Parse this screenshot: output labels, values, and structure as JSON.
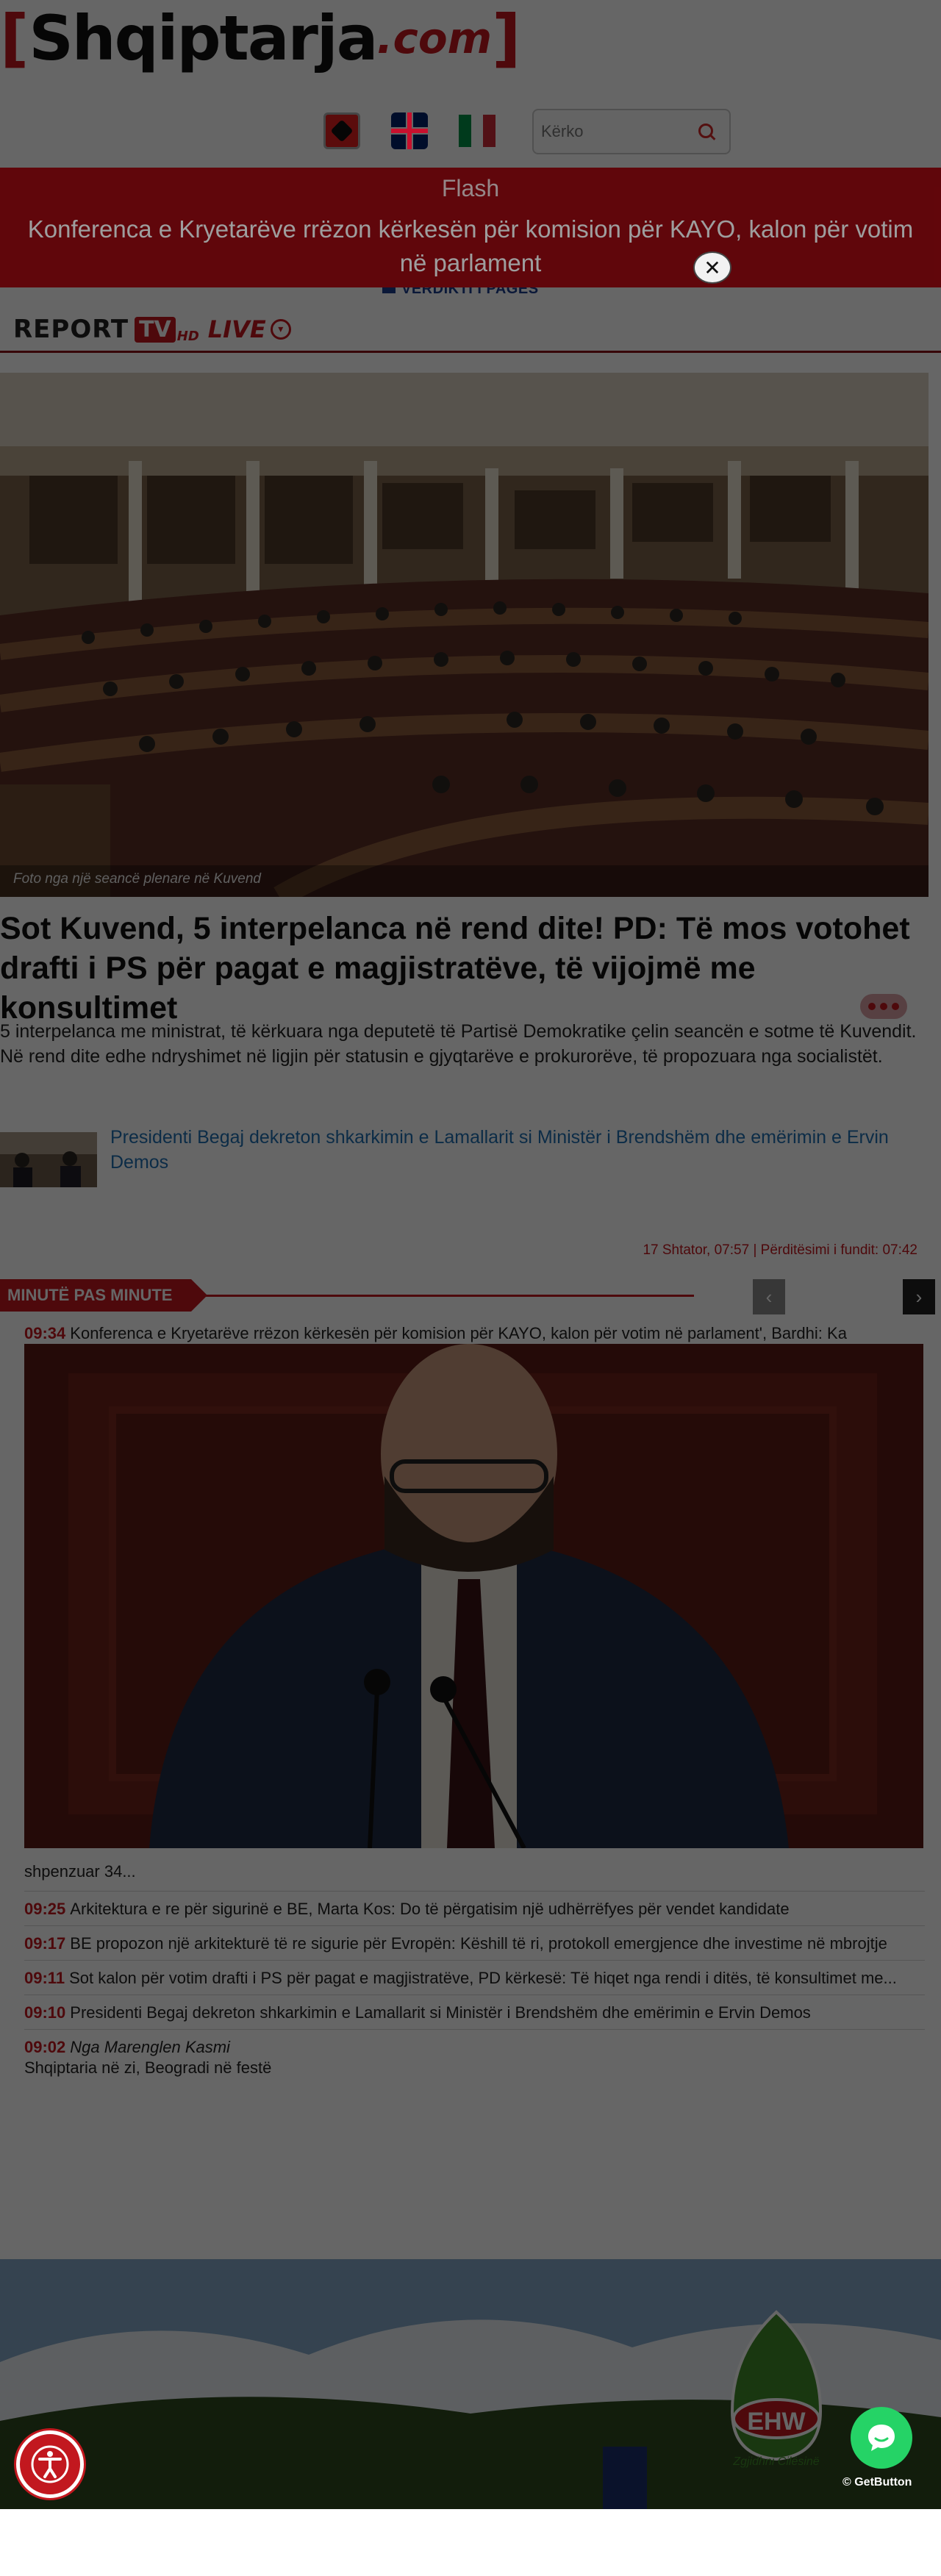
{
  "site": {
    "logo_left_bracket": "[",
    "logo_name": "Shqiptarja",
    "logo_suffix": ".com",
    "logo_right_bracket": "]"
  },
  "languages": [
    {
      "name": "albanian-flag-icon"
    },
    {
      "name": "uk-flag-icon"
    },
    {
      "name": "italian-flag-icon"
    }
  ],
  "search": {
    "placeholder": "Kërko",
    "icon": "search-icon"
  },
  "flash": {
    "title": "Flash",
    "text": "Konferenca e Kryetarëve rrëzon kërkesën për komision për KAYO, kalon për votim në parlament",
    "close_symbol": "✕"
  },
  "verdict_link": "VERDIKTI I PAGËS",
  "report_tv": {
    "report": "REPORT",
    "tv": "TV",
    "hd": "HD",
    "live": "LIVE",
    "arrow": "▾"
  },
  "article": {
    "image_caption": "Foto nga një seancë plenare në Kuvend",
    "headline": "Sot Kuvend, 5 interpelanca në rend dite! PD: Të mos votohet drafti i PS për pagat e magjistratëve, të vijojmë me konsultimet",
    "lead": "5 interpelanca me ministrat, të kërkuara nga deputetë të Partisë Demokratike çelin seancën e sotme të Kuvendit. Në rend dite edhe ndryshimet në ligjin për statusin e gjyqtarëve e prokurorëve, të propozuara nga socialistët.",
    "related": "Presidenti Begaj dekreton shkarkimin e Lamallarit si Ministër i Brendshëm dhe emërimin e Ervin Demos",
    "updated": "17 Shtator, 07:57 | Përditësimi i fundit: 07:42"
  },
  "minute": {
    "label": "MINUTË PAS MINUTE",
    "prev": "‹",
    "next": "›",
    "first": {
      "time": "09:34",
      "text": "Konferenca e Kryetarëve rrëzon kërkesën për komision për KAYO, kalon për votim në parlament', Bardhi: Ka",
      "continuation": "shpenzuar 34..."
    },
    "items": [
      {
        "time": "09:25",
        "text": "Arkitektura e re për sigurinë e BE, Marta Kos: Do të përgatisim një udhërrëfyes për vendet kandidate"
      },
      {
        "time": "09:17",
        "text": "BE propozon një arkitekturë të re sigurie për Evropën: Këshill të ri, protokoll emergjence dhe investime në mbrojtje"
      },
      {
        "time": "09:11",
        "text": "Sot kalon për votim drafti i PS për pagat e magjistratëve, PD kërkesë: Të hiqet nga rendi i ditës, të konsultimet me..."
      },
      {
        "time": "09:10",
        "text": "Presidenti Begaj dekreton shkarkimin e Lamallarit si Ministër i Brendshëm dhe emërimin e Ervin Demos"
      }
    ],
    "last": {
      "time": "09:02",
      "byline": "Nga Marenglen Kasmi",
      "text": "Shqiptaria në zi, Beogradi në festë"
    }
  },
  "ad": {
    "brand": "EHW",
    "slogan": "Zgjidhni Cilësinë"
  },
  "widgets": {
    "get_button": "GetButton"
  }
}
